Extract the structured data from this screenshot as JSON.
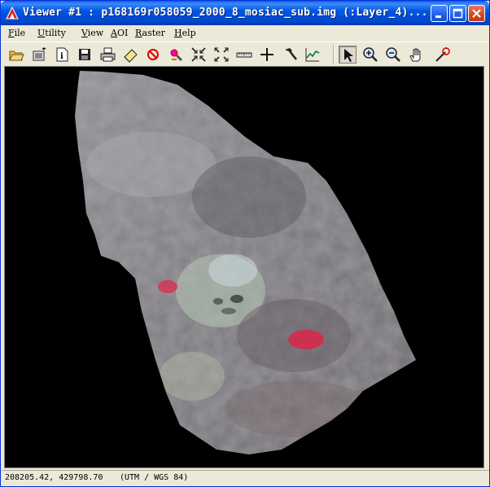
{
  "window": {
    "title": "Viewer #1 : p168169r058059_2000_8_mosiac_sub.img (:Layer_4)...",
    "controls": [
      "minimize",
      "maximize",
      "close"
    ]
  },
  "menu": {
    "items": [
      {
        "label": "File"
      },
      {
        "label": "Utility"
      },
      {
        "label": "View"
      },
      {
        "label": "AOI"
      },
      {
        "label": "Raster"
      },
      {
        "label": "Help"
      }
    ]
  },
  "toolbar": {
    "tools": [
      "open-folder-icon",
      "new-layer-icon",
      "info-icon",
      "save-icon",
      "print-icon",
      "eraser-icon",
      "clear-icon",
      "pan-locate-icon",
      "shrink-icon",
      "fit-icon",
      "ruler-icon",
      "crosshair-icon",
      "hammer-icon",
      "profile-chart-icon",
      "select-arrow-icon",
      "zoom-in-icon",
      "zoom-out-icon",
      "pan-hand-icon",
      "magic-wand-icon"
    ],
    "active_tool": "select-arrow-icon"
  },
  "viewer": {
    "background": "#000000",
    "content": "satellite-image-mosaic"
  },
  "status": {
    "coordinates": "208205.42, 429798.70",
    "projection": "(UTM / WGS 84)"
  }
}
